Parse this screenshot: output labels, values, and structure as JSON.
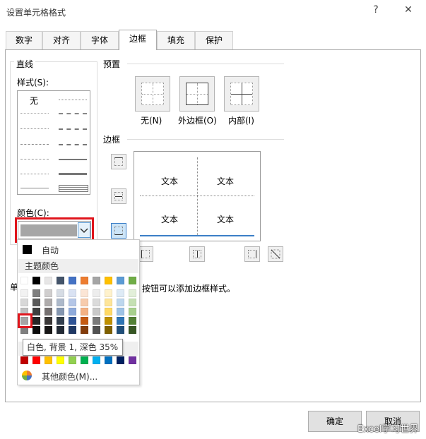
{
  "window": {
    "title": "设置单元格格式",
    "help": "?",
    "close": "✕"
  },
  "tabs": [
    "数字",
    "对齐",
    "字体",
    "边框",
    "填充",
    "保护"
  ],
  "line": {
    "group_label": "直线",
    "style_label": "样式(S):",
    "none_label": "无",
    "color_label": "颜色(C):"
  },
  "presets": {
    "group_label": "预置",
    "none": "无(N)",
    "outline": "外边框(O)",
    "inside": "内部(I)"
  },
  "border": {
    "group_label": "边框",
    "preview_text": "文本"
  },
  "hint": {
    "prefix": "单",
    "text": "按钮可以添加边框样式。"
  },
  "color_popup": {
    "auto": "自动",
    "theme_header": "主题颜色",
    "more": "其他颜色(M)...",
    "tooltip": "白色, 背景 1, 深色 35%",
    "theme_top": [
      "#ffffff",
      "#000000",
      "#e7e6e6",
      "#44546a",
      "#4472c4",
      "#ed7d31",
      "#a5a5a5",
      "#ffc000",
      "#5b9bd5",
      "#70ad47"
    ],
    "theme_shades": [
      [
        "#f2f2f2",
        "#7f7f7f",
        "#d0cece",
        "#d6dce4",
        "#d9e2f3",
        "#fbe5d5",
        "#ededed",
        "#fff2cc",
        "#deebf6",
        "#e2efd9"
      ],
      [
        "#d8d8d8",
        "#595959",
        "#aeabab",
        "#adb9ca",
        "#b4c6e7",
        "#f7cbac",
        "#dbdbdb",
        "#fee599",
        "#bdd7ee",
        "#c5e0b3"
      ],
      [
        "#bfbfbf",
        "#3f3f3f",
        "#757070",
        "#8496b0",
        "#8eaadb",
        "#f4b183",
        "#c9c9c9",
        "#ffd965",
        "#9dc3e6",
        "#a8d08d"
      ],
      [
        "#a5a5a5",
        "#262626",
        "#3a3838",
        "#323f4f",
        "#2f5496",
        "#c55a11",
        "#7b7b7b",
        "#bf9000",
        "#2e75b5",
        "#538135"
      ],
      [
        "#7f7f7f",
        "#0c0c0c",
        "#171616",
        "#222a35",
        "#1f3864",
        "#833c0b",
        "#525252",
        "#7f6000",
        "#1f4e79",
        "#375623"
      ]
    ],
    "standard": [
      "#c00000",
      "#ff0000",
      "#ffc000",
      "#ffff00",
      "#92d050",
      "#00b050",
      "#00b0f0",
      "#0070c0",
      "#002060",
      "#7030a0"
    ]
  },
  "buttons": {
    "ok": "确定",
    "cancel": "取消"
  },
  "watermark": "Excel学习世界"
}
